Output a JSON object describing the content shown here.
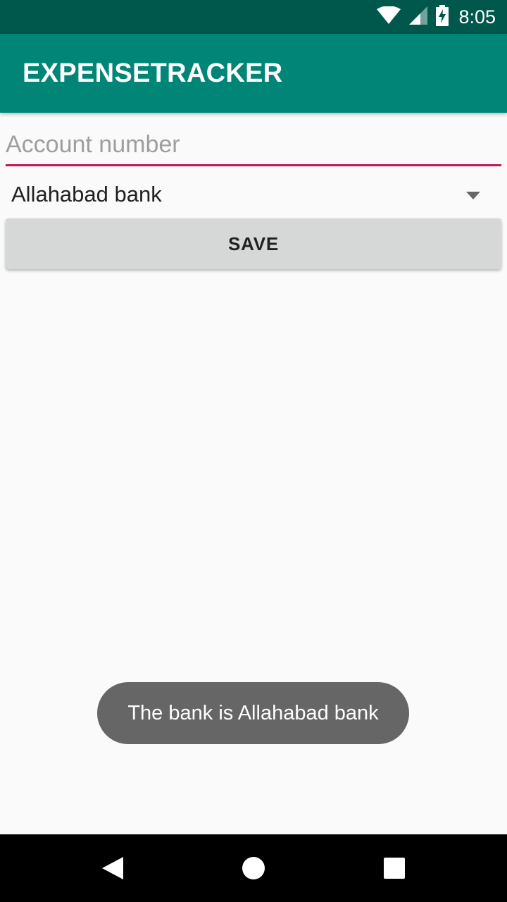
{
  "status_bar": {
    "time": "8:05",
    "icons": [
      "wifi-icon",
      "cell-signal-icon",
      "battery-charging-icon"
    ]
  },
  "app_bar": {
    "title": "EXPENSETRACKER"
  },
  "form": {
    "account_number": {
      "value": "",
      "placeholder": "Account number"
    },
    "bank_spinner": {
      "selected": "Allahabad bank"
    },
    "save_label": "SAVE"
  },
  "toast": {
    "message": "The bank is Allahabad bank"
  },
  "nav_bar": {
    "buttons": [
      "back-icon",
      "home-icon",
      "recents-icon"
    ]
  },
  "colors": {
    "status_bar": "#00574b",
    "primary": "#008577",
    "accent": "#c2185b",
    "button": "#d6d7d7",
    "toast": "#666666"
  }
}
